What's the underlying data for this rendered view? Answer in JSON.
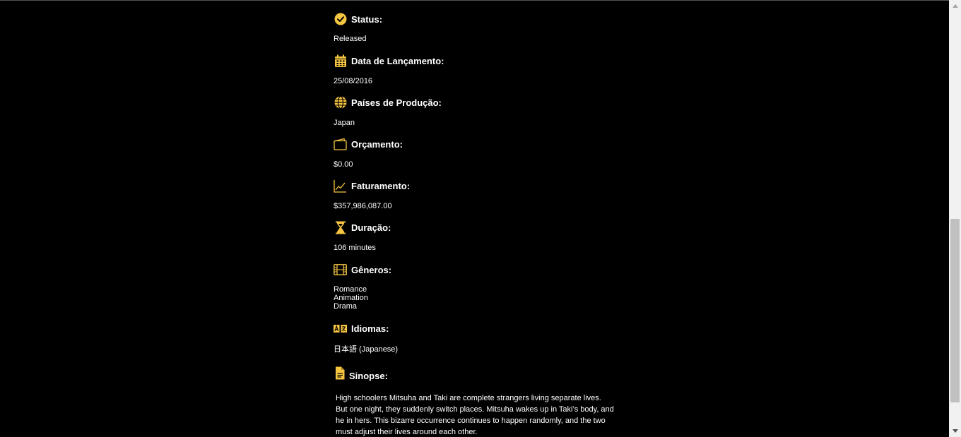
{
  "colors": {
    "accent": "#f5c542",
    "background": "#000000",
    "text": "#ffffff"
  },
  "details": {
    "status": {
      "label": "Status:",
      "value": "Released",
      "icon": "check-circle-icon"
    },
    "release_date": {
      "label": "Data de Lançamento:",
      "value": "25/08/2016",
      "icon": "calendar-icon"
    },
    "countries": {
      "label": "Países de Produção:",
      "value": "Japan",
      "icon": "globe-icon"
    },
    "budget": {
      "label": "Orçamento:",
      "value": "$0.00",
      "icon": "wallet-icon"
    },
    "revenue": {
      "label": "Faturamento:",
      "value": "$357,986,087.00",
      "icon": "line-chart-icon"
    },
    "runtime": {
      "label": "Duração:",
      "value": "106 minutes",
      "icon": "hourglass-icon"
    },
    "genres": {
      "label": "Gêneros:",
      "values": [
        "Romance",
        "Animation",
        "Drama"
      ],
      "icon": "film-icon"
    },
    "languages": {
      "label": "Idiomas:",
      "value": "日本語 (Japanese)",
      "icon": "translate-icon"
    },
    "synopsis": {
      "label": "Sinopse:",
      "icon": "document-icon",
      "text": "High schoolers Mitsuha and Taki are complete strangers living separate lives. But one night, they suddenly switch places. Mitsuha wakes up in Taki’s body, and he in hers. This bizarre occurrence continues to happen randomly, and the two must adjust their lives around each other."
    }
  }
}
